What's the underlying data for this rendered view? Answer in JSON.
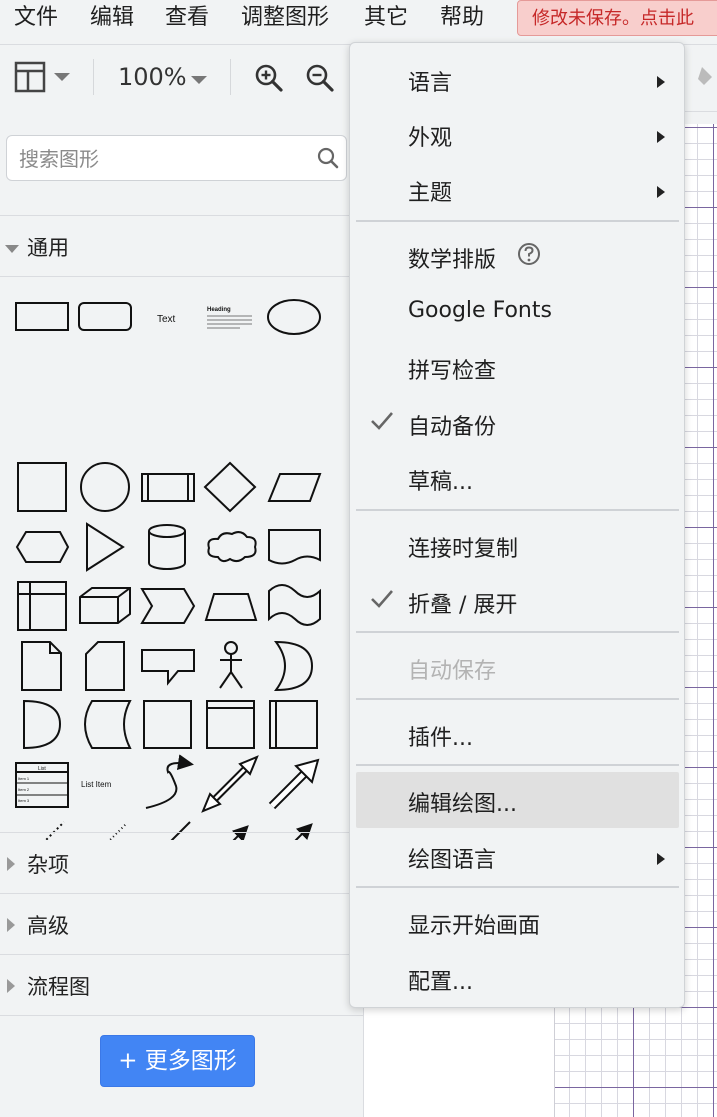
{
  "menubar": {
    "items": [
      "文件",
      "编辑",
      "查看",
      "调整图形",
      "其它",
      "帮助"
    ],
    "unsaved_notice": "修改未保存。点击此"
  },
  "toolbar": {
    "zoom": "100%"
  },
  "sidebar": {
    "search_placeholder": "搜索图形",
    "sections": {
      "general": "通用",
      "misc": "杂项",
      "advanced": "高级",
      "flowchart": "流程图"
    },
    "shape_texts": {
      "text": "Text",
      "heading": "Heading",
      "list_item": "List Item",
      "list": "List",
      "item1": "Item 1",
      "item2": "Item 2",
      "item3": "Item 3"
    },
    "more_shapes": "+ 更多图形"
  },
  "menu": {
    "language": "语言",
    "appearance": "外观",
    "theme": "主题",
    "math": "数学排版",
    "google_fonts": "Google Fonts",
    "spellcheck": "拼写检查",
    "autobackup": "自动备份",
    "drafts": "草稿...",
    "copy_on_connect": "连接时复制",
    "collapse_expand": "折叠 / 展开",
    "autosave": "自动保存",
    "plugins": "插件...",
    "edit_diagram": "编辑绘图...",
    "diagram_language": "绘图语言",
    "show_start_screen": "显示开始画面",
    "configuration": "配置..."
  }
}
